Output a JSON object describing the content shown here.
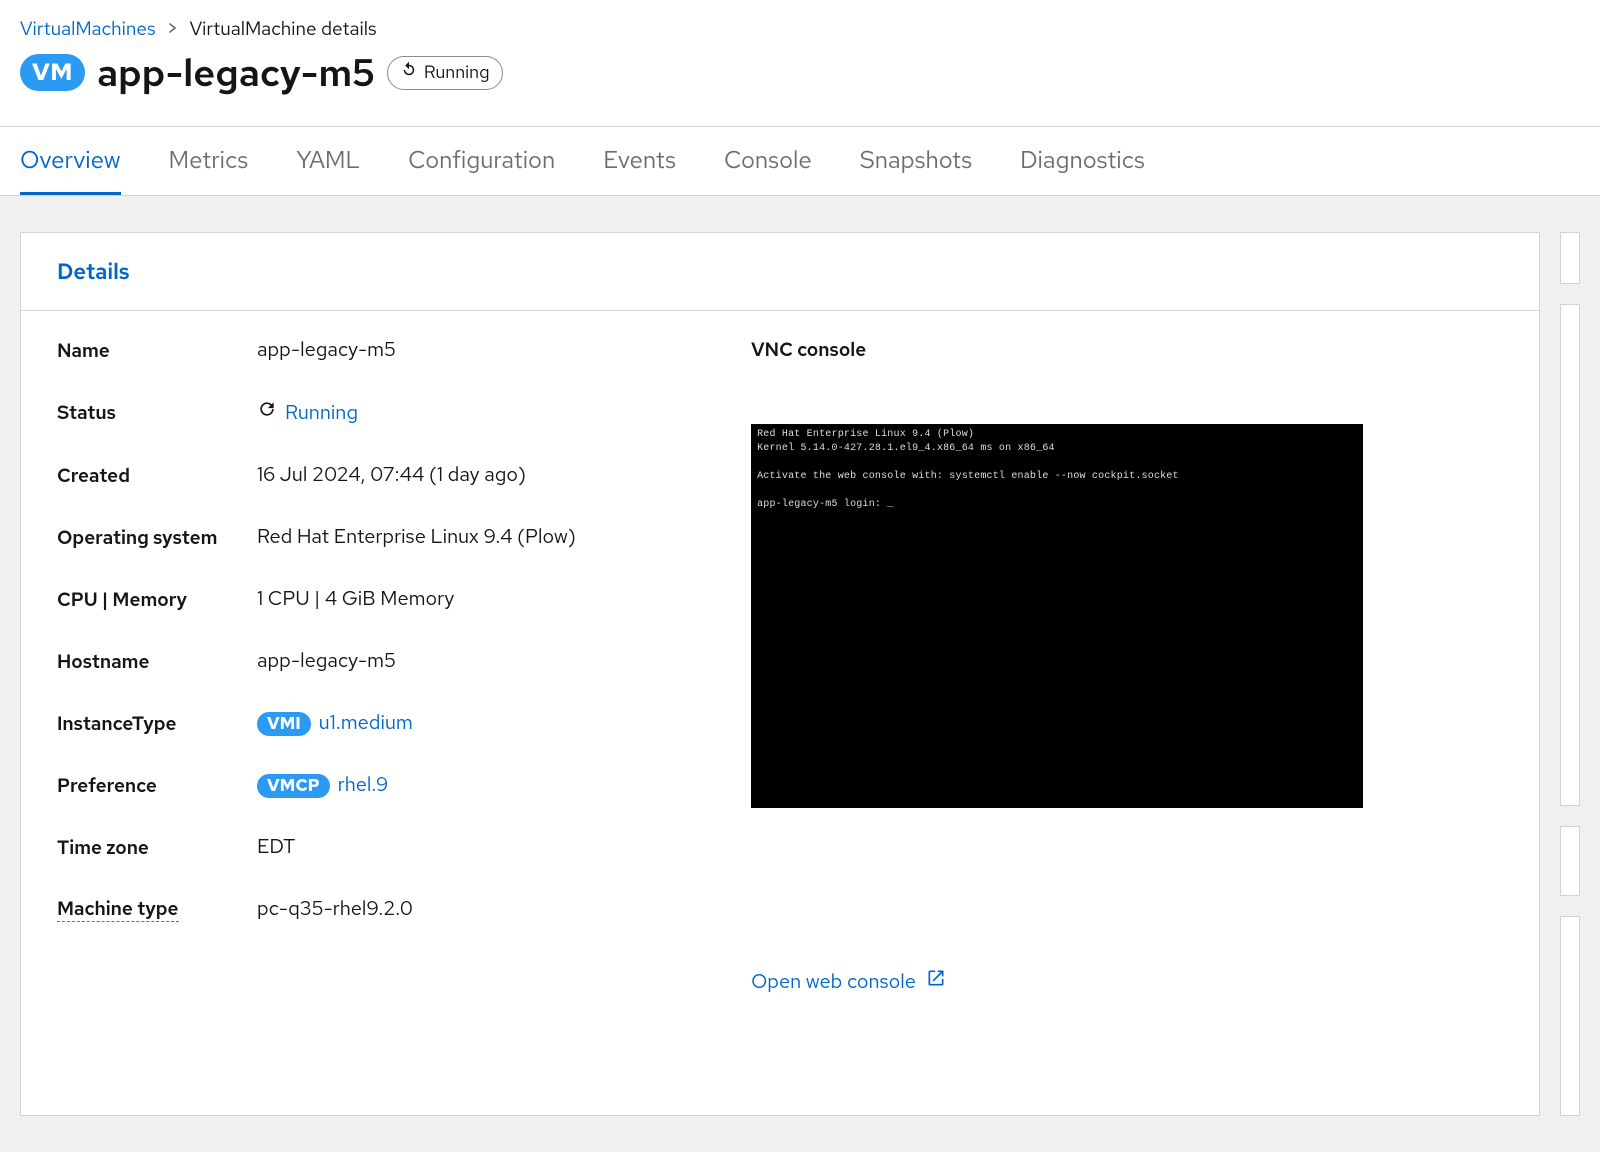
{
  "breadcrumb": {
    "root": "VirtualMachines",
    "current": "VirtualMachine details"
  },
  "header": {
    "badge": "VM",
    "title": "app-legacy-m5",
    "status": "Running"
  },
  "tabs": [
    {
      "label": "Overview",
      "active": true
    },
    {
      "label": "Metrics"
    },
    {
      "label": "YAML"
    },
    {
      "label": "Configuration"
    },
    {
      "label": "Events"
    },
    {
      "label": "Console"
    },
    {
      "label": "Snapshots"
    },
    {
      "label": "Diagnostics"
    }
  ],
  "card": {
    "title": "Details",
    "fields": {
      "name_label": "Name",
      "name_value": "app-legacy-m5",
      "status_label": "Status",
      "status_value": "Running",
      "created_label": "Created",
      "created_value": "16 Jul 2024, 07:44 (1 day ago)",
      "os_label": "Operating system",
      "os_value": "Red Hat Enterprise Linux 9.4 (Plow)",
      "cpumem_label": "CPU | Memory",
      "cpumem_value": "1 CPU | 4 GiB Memory",
      "hostname_label": "Hostname",
      "hostname_value": "app-legacy-m5",
      "instancetype_label": "InstanceType",
      "instancetype_badge": "VMI",
      "instancetype_value": "u1.medium",
      "preference_label": "Preference",
      "preference_badge": "VMCP",
      "preference_value": "rhel.9",
      "timezone_label": "Time zone",
      "timezone_value": "EDT",
      "machinetype_label": "Machine type",
      "machinetype_value": "pc-q35-rhel9.2.0"
    },
    "console": {
      "title": "VNC console",
      "text_line1": "Red Hat Enterprise Linux 9.4 (Plow)",
      "text_line2": "Kernel 5.14.0-427.28.1.el9_4.x86_64 ms on x86_64",
      "text_line3": "Activate the web console with: systemctl enable --now cockpit.socket",
      "text_line4": "app-legacy-m5 login: _",
      "open_label": "Open web console"
    }
  }
}
